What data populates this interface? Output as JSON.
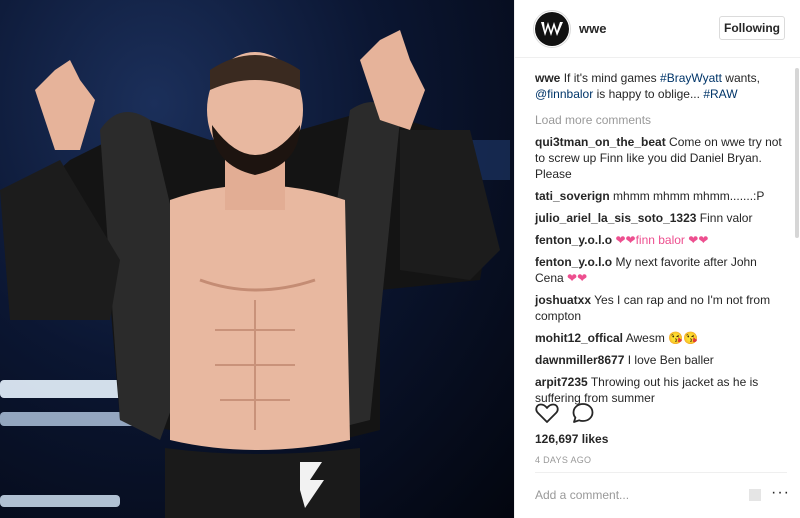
{
  "post": {
    "username": "wwe",
    "follow_label": "Following",
    "caption_user": "wwe",
    "caption_pre": "If it's mind games",
    "caption_tag1": "#BrayWyatt",
    "caption_mid": "wants,",
    "caption_mention": "@finnbalor",
    "caption_post": "is happy to oblige...",
    "caption_tag2": "#RAW",
    "load_more": "Load more comments",
    "likes": "126,697 likes",
    "date": "4 DAYS AGO",
    "add_comment_placeholder": "Add a comment...",
    "more_label": "···"
  },
  "comments": [
    {
      "user": "qui3tman_on_the_beat",
      "text": "Come on wwe try not to screw up Finn like you did Daniel Bryan. Please"
    },
    {
      "user": "tati_soverign",
      "text": "mhmm mhmm mhmm.......:P"
    },
    {
      "user": "julio_ariel_la_sis_soto_1323",
      "text": "Finn valor"
    },
    {
      "user": "fenton_y.o.l.o",
      "text_a": "❤❤finn balor ❤❤"
    },
    {
      "user": "fenton_y.o.l.o",
      "text": "My next favorite after John Cena",
      "emoji": "❤❤"
    },
    {
      "user": "joshuatxx",
      "text": "Yes I can rap and no I'm not from compton"
    },
    {
      "user": "mohit12_offical",
      "text": "Awesm",
      "emoji": "😘😘"
    },
    {
      "user": "dawnmiller8677",
      "text": "I love Ben baller"
    },
    {
      "user": "arpit7235",
      "text": "Throwing out his jacket as he is suffering from summer"
    }
  ],
  "icons": {
    "heart": "heart-icon",
    "comment": "comment-bubble-icon",
    "avatar": "wwe-logo"
  },
  "colors": {
    "link": "#003569",
    "muted": "#999999",
    "heart_emoji": "#ed4f8f"
  }
}
